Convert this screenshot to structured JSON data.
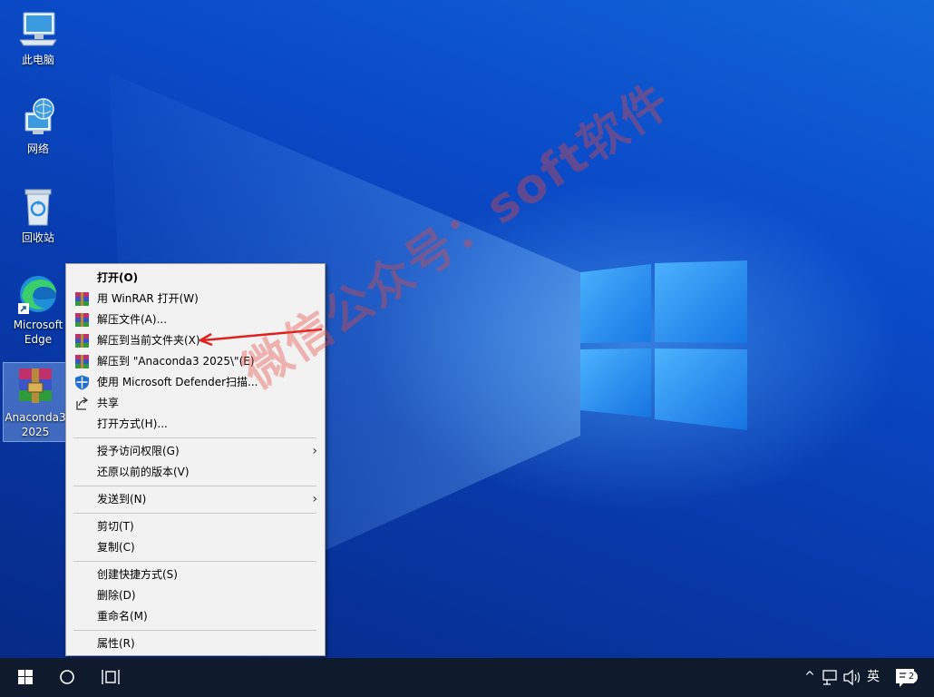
{
  "desktop": {
    "icons": [
      {
        "label": "此电脑"
      },
      {
        "label": "网络"
      },
      {
        "label": "回收站"
      },
      {
        "label_line1": "Microsoft",
        "label_line2": "Edge"
      },
      {
        "label_line1": "Anaconda3",
        "label_line2": "2025"
      }
    ]
  },
  "watermark": "微信公众号：soft软件",
  "context_menu": {
    "items": [
      {
        "label": "打开(O)"
      },
      {
        "label": "用 WinRAR 打开(W)"
      },
      {
        "label": "解压文件(A)..."
      },
      {
        "label": "解压到当前文件夹(X)"
      },
      {
        "label": "解压到 \"Anaconda3 2025\\\"(E)"
      },
      {
        "label": "使用 Microsoft Defender扫描..."
      },
      {
        "label": "共享"
      },
      {
        "label": "打开方式(H)..."
      },
      {
        "label": "授予访问权限(G)"
      },
      {
        "label": "还原以前的版本(V)"
      },
      {
        "label": "发送到(N)"
      },
      {
        "label": "剪切(T)"
      },
      {
        "label": "复制(C)"
      },
      {
        "label": "创建快捷方式(S)"
      },
      {
        "label": "删除(D)"
      },
      {
        "label": "重命名(M)"
      },
      {
        "label": "属性(R)"
      }
    ],
    "submenu_arrow": "›"
  },
  "taskbar": {
    "tray_chevron": "^",
    "ime_label": "英",
    "notification_count": "2"
  },
  "colors": {
    "annotation_red": "#e0201c",
    "winrar_pink": "#c0306a",
    "taskbar_bg": "#0f1a2c",
    "menu_bg": "#f2f2f2"
  }
}
